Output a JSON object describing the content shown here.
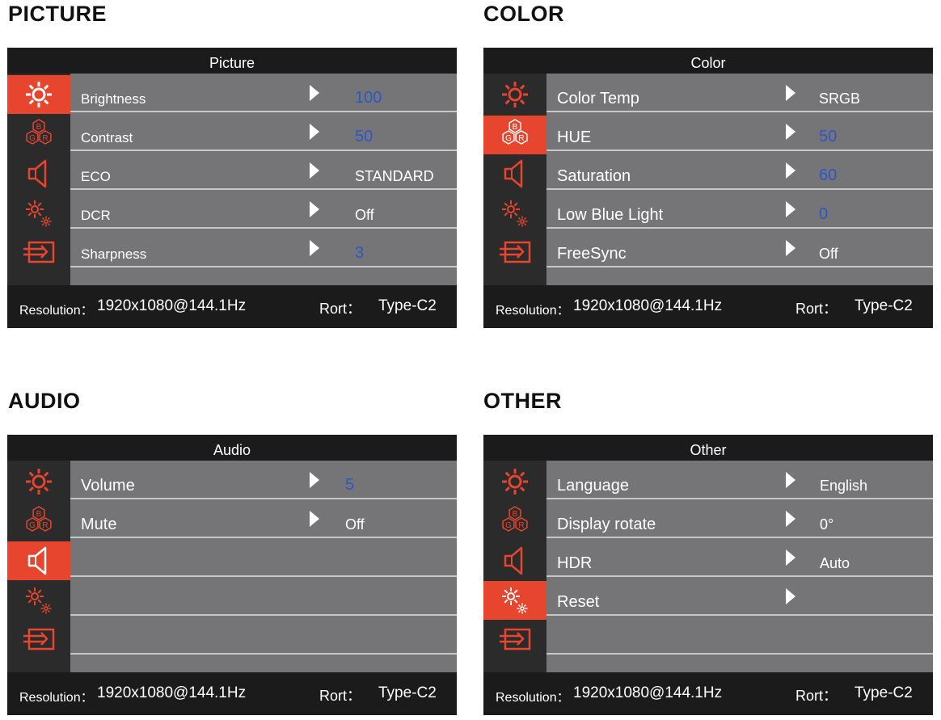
{
  "colors": {
    "accent": "#e8452f",
    "value_blue": "#2a58c8",
    "row_bg": "#757577",
    "header_bg": "#1b1b1b"
  },
  "icons": [
    "sun-icon",
    "rgb-icon",
    "speaker-icon",
    "settings-gear-icon",
    "input-source-icon"
  ],
  "footer": {
    "resolution_label": "Resolution：",
    "resolution_value": "1920x1080@144.1Hz",
    "port_label": "Rort：",
    "port_value": "Type-C2"
  },
  "panels": [
    {
      "section": "PICTURE",
      "header": "Picture",
      "active_icon": 0,
      "rows": [
        {
          "label": "Brightness",
          "value": "100",
          "num": true
        },
        {
          "label": "Contrast",
          "value": "50",
          "num": true
        },
        {
          "label": "ECO",
          "value": "STANDARD",
          "num": false
        },
        {
          "label": "DCR",
          "value": "Off",
          "num": false
        },
        {
          "label": "Sharpness",
          "value": "3",
          "num": true
        }
      ]
    },
    {
      "section": "COLOR",
      "header": "Color",
      "active_icon": 1,
      "rows": [
        {
          "label": "Color  Temp",
          "value": "SRGB",
          "num": false
        },
        {
          "label": "HUE",
          "value": "50",
          "num": true
        },
        {
          "label": "Saturation",
          "value": "60",
          "num": true
        },
        {
          "label": "Low Blue Light",
          "value": "0",
          "num": true
        },
        {
          "label": "FreeSync",
          "value": "Off",
          "num": false
        }
      ]
    },
    {
      "section": "AUDIO",
      "header": "Audio",
      "active_icon": 2,
      "rows": [
        {
          "label": "Volume",
          "value": "5",
          "num": true
        },
        {
          "label": "Mute",
          "value": "Off",
          "num": false
        },
        {
          "label": "",
          "value": "",
          "num": false
        },
        {
          "label": "",
          "value": "",
          "num": false
        },
        {
          "label": "",
          "value": "",
          "num": false
        }
      ]
    },
    {
      "section": "OTHER",
      "header": "Other",
      "active_icon": 3,
      "rows": [
        {
          "label": "Language",
          "value": "English",
          "num": false
        },
        {
          "label": "Display rotate",
          "value": "0°",
          "num": false
        },
        {
          "label": "HDR",
          "value": "Auto",
          "num": false
        },
        {
          "label": "Reset",
          "value": "",
          "num": false
        },
        {
          "label": "",
          "value": "",
          "num": false
        }
      ]
    }
  ]
}
